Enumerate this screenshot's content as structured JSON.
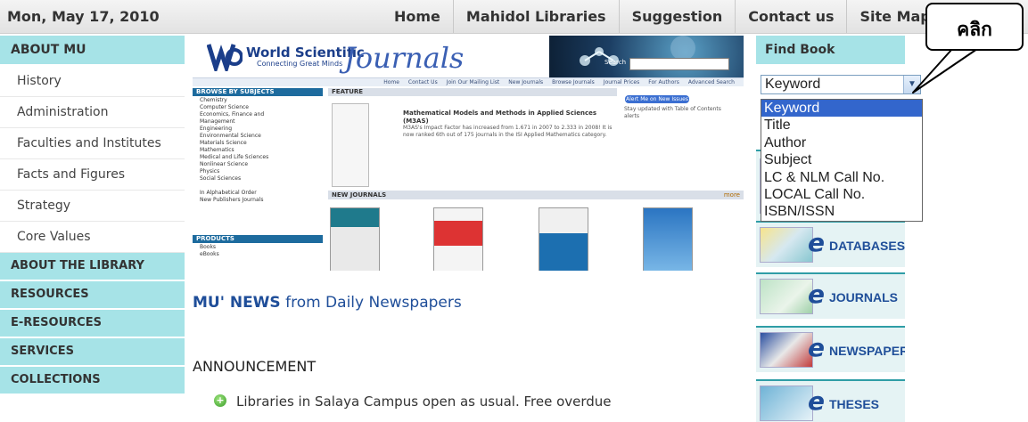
{
  "topbar": {
    "date": "Mon, May 17, 2010",
    "nav": [
      "Home",
      "Mahidol Libraries",
      "Suggestion",
      "Contact us",
      "Site Map"
    ]
  },
  "sidebar": {
    "about_mu": "ABOUT MU",
    "items": [
      "History",
      "Administration",
      "Faculties and Institutes",
      "Facts and Figures",
      "Strategy",
      "Core Values"
    ],
    "sections": [
      "ABOUT THE LIBRARY",
      "RESOURCES",
      "E-RESOURCES",
      "SERVICES",
      "COLLECTIONS"
    ]
  },
  "banner": {
    "publisher": "World Scientific",
    "tagline": "Connecting Great Minds",
    "journals": "Journals",
    "search_label": "Search",
    "links": [
      "Home",
      "Contact Us",
      "Join Our Mailing List",
      "New Journals",
      "Browse Journals",
      "Journal Prices",
      "For Authors",
      "Advanced Search"
    ],
    "browse_header": "BROWSE BY SUBJECTS",
    "subjects": [
      "Chemistry",
      "Computer Science",
      "Economics, Finance and",
      "Management",
      "Engineering",
      "Environmental Science",
      "Materials Science",
      "Mathematics",
      "Medical and Life Sciences",
      "Nonlinear Science",
      "Physics",
      "Social Sciences",
      "",
      "In Alphabetical Order",
      "New Publishers Journals"
    ],
    "products_header": "PRODUCTS",
    "products": [
      "Books",
      "eBooks"
    ],
    "feature_header": "FEATURE",
    "feature_title": "Mathematical Models and Methods in Applied Sciences",
    "feature_abbr": "(M3AS)",
    "feature_text": "M3AS's Impact Factor has increased from 1.671 in 2007 to 2.333 in 2008! It is now ranked 6th out of 175 journals in the ISI Applied Mathematics category.",
    "feature_more": "more",
    "alert_button": "Alert Me on New Issues",
    "alert_text": "Stay updated with Table of Contents alerts",
    "new_journals_header": "NEW JOURNALS",
    "new_journals_more": "more"
  },
  "news": {
    "bold": "MU' NEWS",
    "rest": " from Daily Newspapers"
  },
  "announcement": {
    "title": "ANNOUNCEMENT",
    "item": "Libraries in Salaya Campus open as usual. Free overdue"
  },
  "find_book": {
    "title": "Find Book",
    "selected": "Keyword",
    "options": [
      "Keyword",
      "Title",
      "Author",
      "Subject",
      "LC & NLM Call No.",
      "LOCAL Call No.",
      "ISBN/ISSN"
    ]
  },
  "promos": [
    "DATABASES",
    "JOURNALS",
    "NEWSPAPERS",
    "THESES"
  ],
  "callout": {
    "text": "คลิก"
  },
  "colors": {
    "sidebar_header": "#a6e3e7",
    "selected_option": "#3366cc",
    "link_blue": "#1f4e99"
  }
}
